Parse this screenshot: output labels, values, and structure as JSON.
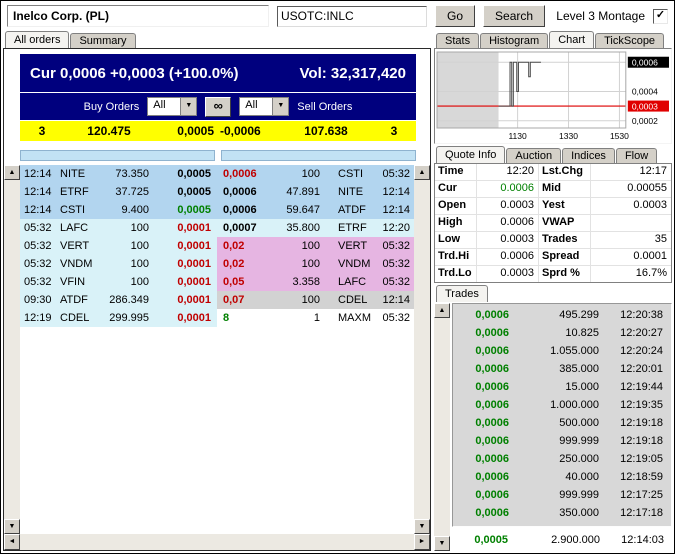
{
  "icons": {
    "check": "✓",
    "link": "∞",
    "up": "▲",
    "down": "▼",
    "left": "◄",
    "right": "►",
    "select_arrow": "▼"
  },
  "colors": {
    "ticker_bg": "#00007e",
    "summary_bg": "#ffff00",
    "best_row": "#b2d5ef",
    "depth_row": "#d9f2f8",
    "pink_row": "#e6b5e2",
    "gray_row": "#d2d2d2",
    "up_green": "#008000",
    "down_red": "#c00000",
    "chart_ref_red": "#e00000"
  },
  "header": {
    "title": "Inelco Corp. (PL)",
    "symbol_value": "USOTC:INLC",
    "go_label": "Go",
    "search_label": "Search",
    "montage_label": "Level 3 Montage",
    "montage_checked": true
  },
  "left": {
    "tabs": [
      {
        "label": "All orders",
        "active": true
      },
      {
        "label": "Summary",
        "active": false
      }
    ],
    "ticker": {
      "cur_text": "Cur 0,0006 +0,0003 (+100.0%)",
      "vol_text": "Vol: 32,317,420"
    },
    "filters": {
      "buy_label": "Buy Orders",
      "buy_value": "All",
      "sell_label": "Sell Orders",
      "sell_value": "All"
    },
    "summary": {
      "buy_count": "3",
      "buy_size": "120.475",
      "bid": "0,0005",
      "ask": "-0,0006",
      "sell_size": "107.638",
      "sell_count": "3"
    },
    "buy_rows": [
      {
        "time": "12:14",
        "mm": "NITE",
        "size": "73.350",
        "price": "0,0005",
        "price_class": "p-black",
        "row_class": "bg-blue"
      },
      {
        "time": "12:14",
        "mm": "ETRF",
        "size": "37.725",
        "price": "0,0005",
        "price_class": "p-black",
        "row_class": "bg-blue"
      },
      {
        "time": "12:14",
        "mm": "CSTI",
        "size": "9.400",
        "price": "0,0005",
        "price_class": "p-green",
        "row_class": "bg-blue"
      },
      {
        "time": "05:32",
        "mm": "LAFC",
        "size": "100",
        "price": "0,0001",
        "price_class": "p-red",
        "row_class": "bg-cyan"
      },
      {
        "time": "05:32",
        "mm": "VERT",
        "size": "100",
        "price": "0,0001",
        "price_class": "p-red",
        "row_class": "bg-cyan"
      },
      {
        "time": "05:32",
        "mm": "VNDM",
        "size": "100",
        "price": "0,0001",
        "price_class": "p-red",
        "row_class": "bg-cyan"
      },
      {
        "time": "05:32",
        "mm": "VFIN",
        "size": "100",
        "price": "0,0001",
        "price_class": "p-red",
        "row_class": "bg-cyan"
      },
      {
        "time": "09:30",
        "mm": "ATDF",
        "size": "286.349",
        "price": "0,0001",
        "price_class": "p-red",
        "row_class": "bg-cyan"
      },
      {
        "time": "12:19",
        "mm": "CDEL",
        "size": "299.995",
        "price": "0,0001",
        "price_class": "p-red",
        "row_class": "bg-cyan"
      }
    ],
    "sell_rows": [
      {
        "price": "0,0006",
        "size": "100",
        "mm": "CSTI",
        "time": "05:32",
        "price_class": "p-red",
        "row_class": "bg-blue"
      },
      {
        "price": "0,0006",
        "size": "47.891",
        "mm": "NITE",
        "time": "12:14",
        "price_class": "p-black",
        "row_class": "bg-blue"
      },
      {
        "price": "0,0006",
        "size": "59.647",
        "mm": "ATDF",
        "time": "12:14",
        "price_class": "p-black",
        "row_class": "bg-blue"
      },
      {
        "price": "0,0007",
        "size": "35.800",
        "mm": "ETRF",
        "time": "12:20",
        "price_class": "p-black",
        "row_class": "bg-cyan"
      },
      {
        "price": "0,02",
        "size": "100",
        "mm": "VERT",
        "time": "05:32",
        "price_class": "p-red",
        "row_class": "bg-pink"
      },
      {
        "price": "0,02",
        "size": "100",
        "mm": "VNDM",
        "time": "05:32",
        "price_class": "p-red",
        "row_class": "bg-pink"
      },
      {
        "price": "0,05",
        "size": "3.358",
        "mm": "LAFC",
        "time": "05:32",
        "price_class": "p-red",
        "row_class": "bg-pink"
      },
      {
        "price": "0,07",
        "size": "100",
        "mm": "CDEL",
        "time": "12:14",
        "price_class": "p-red",
        "row_class": "bg-gray"
      },
      {
        "price": "8",
        "size": "1",
        "mm": "MAXM",
        "time": "05:32",
        "price_class": "p-green",
        "row_class": "bg-white"
      }
    ]
  },
  "right": {
    "chart_tabs": [
      {
        "label": "Stats",
        "active": false
      },
      {
        "label": "Histogram",
        "active": false
      },
      {
        "label": "Chart",
        "active": true
      },
      {
        "label": "TickScope",
        "active": false
      }
    ],
    "quote_tabs": [
      {
        "label": "Quote Info",
        "active": true
      },
      {
        "label": "Auction",
        "active": false
      },
      {
        "label": "Indices",
        "active": false
      },
      {
        "label": "Flow",
        "active": false
      }
    ],
    "quote_rows": [
      {
        "l1": "Time",
        "v1": "12:20",
        "c1": "",
        "l2": "Lst.Chg",
        "v2": "12:17",
        "c2": ""
      },
      {
        "l1": "Cur",
        "v1": "0.0006",
        "c1": "p-green",
        "l2": "Mid",
        "v2": "0.00055",
        "c2": ""
      },
      {
        "l1": "Open",
        "v1": "0.0003",
        "c1": "",
        "l2": "Yest",
        "v2": "0.0003",
        "c2": ""
      },
      {
        "l1": "High",
        "v1": "0.0006",
        "c1": "",
        "l2": "VWAP",
        "v2": "",
        "c2": ""
      },
      {
        "l1": "Low",
        "v1": "0.0003",
        "c1": "",
        "l2": "Trades",
        "v2": "35",
        "c2": ""
      },
      {
        "l1": "Trd.Hi",
        "v1": "0.0006",
        "c1": "",
        "l2": "Spread",
        "v2": "0.0001",
        "c2": ""
      },
      {
        "l1": "Trd.Lo",
        "v1": "0.0003",
        "c1": "",
        "l2": "Sprd %",
        "v2": "16.7%",
        "c2": ""
      }
    ],
    "trades_tab": "Trades",
    "trades": [
      {
        "price": "0,0006",
        "size": "495.299",
        "time": "12:20:38",
        "row_class": "t-gray"
      },
      {
        "price": "0,0006",
        "size": "10.825",
        "time": "12:20:27",
        "row_class": "t-gray"
      },
      {
        "price": "0,0006",
        "size": "1.055.000",
        "time": "12:20:24",
        "row_class": "t-gray"
      },
      {
        "price": "0,0006",
        "size": "385.000",
        "time": "12:20:01",
        "row_class": "t-gray"
      },
      {
        "price": "0,0006",
        "size": "15.000",
        "time": "12:19:44",
        "row_class": "t-gray"
      },
      {
        "price": "0,0006",
        "size": "1.000.000",
        "time": "12:19:35",
        "row_class": "t-gray"
      },
      {
        "price": "0,0006",
        "size": "500.000",
        "time": "12:19:18",
        "row_class": "t-gray"
      },
      {
        "price": "0,0006",
        "size": "999.999",
        "time": "12:19:18",
        "row_class": "t-gray"
      },
      {
        "price": "0,0006",
        "size": "250.000",
        "time": "12:19:05",
        "row_class": "t-gray"
      },
      {
        "price": "0,0006",
        "size": "40.000",
        "time": "12:18:59",
        "row_class": "t-gray"
      },
      {
        "price": "0,0006",
        "size": "999.999",
        "time": "12:17:25",
        "row_class": "t-gray"
      },
      {
        "price": "0,0006",
        "size": "350.000",
        "time": "12:17:18",
        "row_class": "t-gray"
      },
      {
        "price": "0,0005",
        "size": "2.900.000",
        "time": "12:14:03",
        "row_class": "t-white"
      }
    ]
  },
  "chart_data": {
    "type": "line",
    "title": "Intraday price",
    "x_domain_minutes": [
      500,
      945
    ],
    "x_ticks": [
      {
        "label": "1130",
        "minute": 690
      },
      {
        "label": "1330",
        "minute": 810
      },
      {
        "label": "1530",
        "minute": 930
      }
    ],
    "ylim": [
      0.00015,
      0.00067
    ],
    "y_ticks": [
      {
        "label": "0,0006",
        "value": 0.0006,
        "style": "box-black"
      },
      {
        "label": "0,0004",
        "value": 0.0004,
        "style": "plain"
      },
      {
        "label": "0,0003",
        "value": 0.0003,
        "style": "box-red"
      },
      {
        "label": "0,0002",
        "value": 0.0002,
        "style": "plain"
      }
    ],
    "reference_line": {
      "value": 0.0003,
      "color": "#e00000"
    },
    "no_data_region_end_minute": 645,
    "grid": true,
    "legend": false,
    "series": [
      {
        "name": "price",
        "color": "#4a4a4a",
        "step": true,
        "points": [
          [
            645,
            0.0003
          ],
          [
            672,
            0.0003
          ],
          [
            672,
            0.0006
          ],
          [
            676,
            0.0006
          ],
          [
            676,
            0.0003
          ],
          [
            680,
            0.0003
          ],
          [
            680,
            0.0006
          ],
          [
            688,
            0.0006
          ],
          [
            688,
            0.0004
          ],
          [
            692,
            0.0004
          ],
          [
            692,
            0.0006
          ],
          [
            716,
            0.0006
          ],
          [
            716,
            0.0005
          ],
          [
            720,
            0.0005
          ],
          [
            720,
            0.0006
          ],
          [
            745,
            0.0006
          ]
        ]
      }
    ]
  }
}
